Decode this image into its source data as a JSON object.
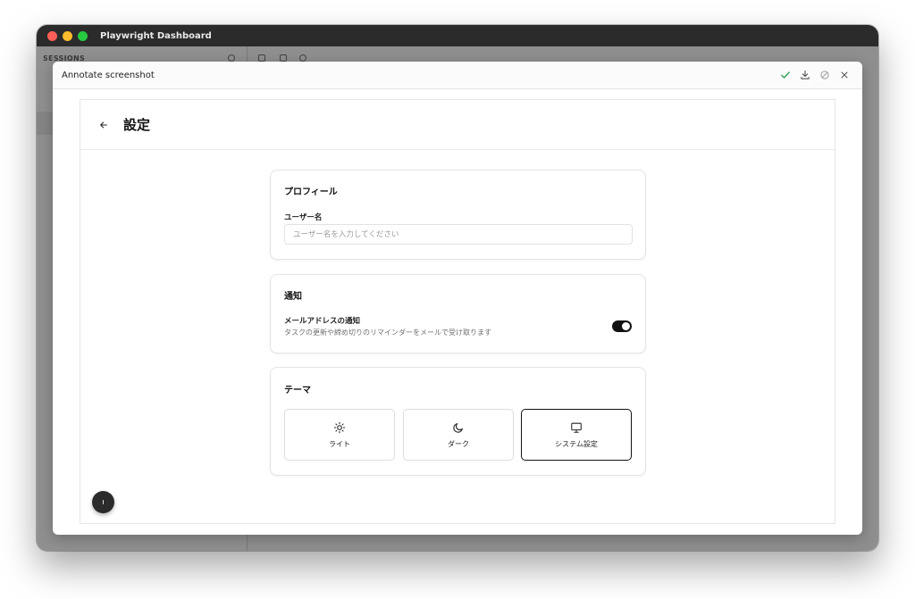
{
  "window": {
    "title": "Playwright Dashboard",
    "sessions_label": "SESSIONS"
  },
  "dialog": {
    "title": "Annotate screenshot"
  },
  "page": {
    "title": "設定"
  },
  "profile": {
    "title": "プロフィール",
    "username_label": "ユーザー名",
    "username_placeholder": "ユーザー名を入力してください",
    "username_value": ""
  },
  "notifications": {
    "title": "通知",
    "email_label": "メールアドレスの通知",
    "email_description": "タスクの更新や締め切りのリマインダーをメールで受け取ります",
    "email_enabled": true
  },
  "theme": {
    "title": "テーマ",
    "options": [
      {
        "label": "ライト",
        "icon": "sun-icon",
        "selected": false
      },
      {
        "label": "ダーク",
        "icon": "moon-icon",
        "selected": false
      },
      {
        "label": "システム設定",
        "icon": "monitor-icon",
        "selected": true
      }
    ]
  },
  "colors": {
    "accept": "#2e9e4f",
    "toggle_on": "#111111"
  }
}
